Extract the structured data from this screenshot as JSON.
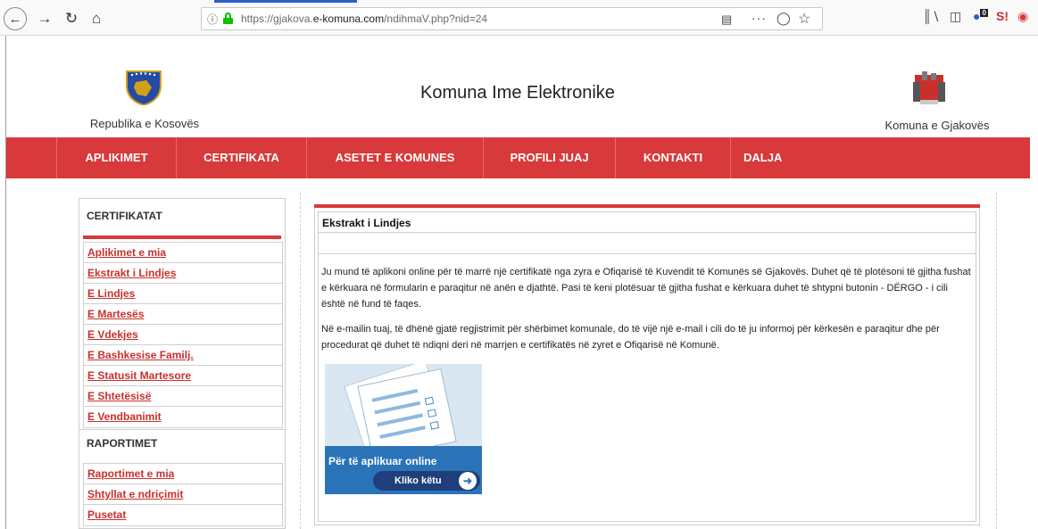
{
  "browser": {
    "url_host": "https://gjakova.",
    "url_domain": "e-komuna.com",
    "url_path": "/ndihmaV.php?nid=24",
    "icons": [
      "back-icon",
      "forward-icon",
      "reload-icon",
      "home-icon",
      "info-icon",
      "lock-icon",
      "reader-icon",
      "more-icon",
      "pocket-icon",
      "bookmark-star-icon",
      "library-icon",
      "sidebar-icon",
      "notification-icon",
      "extension-s-icon",
      "shield-icon"
    ],
    "notification_count": "0"
  },
  "header": {
    "left_label": "Republika e Kosovës",
    "title": "Komuna Ime Elektronike",
    "right_label": "Komuna e Gjakovës"
  },
  "nav": {
    "items": [
      "APLIKIMET",
      "CERTIFIKATA",
      "ASETET E KOMUNES",
      "PROFILI JUAJ",
      "KONTAKTI",
      "DALJA"
    ],
    "color": "#d8393a"
  },
  "sidebar": {
    "section1_title": "CERTIFIKATAT",
    "section1_links": [
      "Aplikimet e mia",
      "Ekstrakt i Lindjes",
      "E Lindjes",
      "E Martesës",
      "E Vdekjes",
      "E Bashkesise Familj.",
      "E Statusit Martesore",
      "E Shtetësisë",
      "E Vendbanimit"
    ],
    "section2_title": "RAPORTIMET",
    "section2_links": [
      "Raportimet e mia",
      "Shtyllat e ndriçimit",
      "Pusetat"
    ]
  },
  "content": {
    "title": "Ekstrakt i Lindjes",
    "paragraph1": "Ju mund të aplikoni online për të marrë një certifikatë nga zyra e Ofiqarisë të Kuvendit të Komunës së Gjakovës. Duhet që të plotësoni të gjitha fushat e kërkuara në formularin e paraqitur në anën e djathtë. Pasi të keni plotësuar të gjitha fushat e kërkuara duhet të shtypni butonin - DËRGO - i cili është në fund të faqes.",
    "paragraph2": "Në e-mailin tuaj, të dhënë gjatë regjistrimit për shërbimet komunale, do të vijë një e-mail i cili do të ju informoj për kërkesën e paraqitur dhe për procedurat që duhet të ndiqni deri në marrjen e certifikatës në zyret e Ofiqarisë në Komunë.",
    "banner_text": "Për të aplikuar online",
    "banner_button": "Kliko këtu"
  }
}
